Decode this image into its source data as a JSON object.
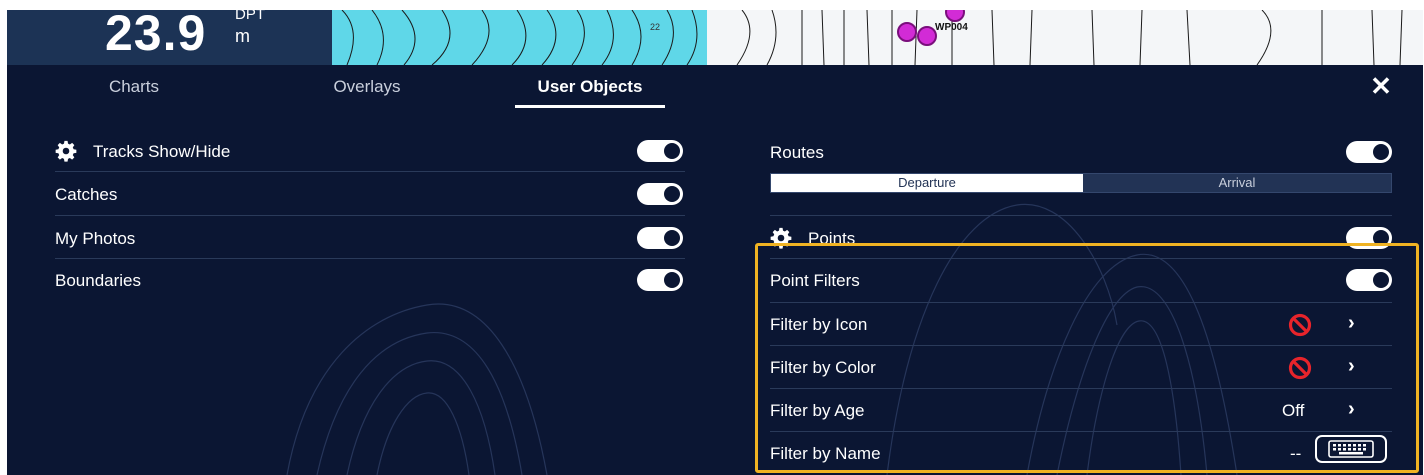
{
  "depth": {
    "value": "23.9",
    "label": "DPT",
    "unit": "m"
  },
  "chart": {
    "sounding": "22",
    "waypoint_label": "WP004"
  },
  "tabs": [
    {
      "label": "Charts",
      "active": false
    },
    {
      "label": "Overlays",
      "active": false
    },
    {
      "label": "User Objects",
      "active": true
    }
  ],
  "close_label": "✕",
  "left_settings": [
    {
      "label": "Tracks Show/Hide",
      "has_gear": true,
      "toggle": "on"
    },
    {
      "label": "Catches",
      "has_gear": false,
      "toggle": "on"
    },
    {
      "label": "My Photos",
      "has_gear": false,
      "toggle": "on"
    },
    {
      "label": "Boundaries",
      "has_gear": false,
      "toggle": "on"
    }
  ],
  "routes": {
    "label": "Routes",
    "toggle": "on",
    "segments": [
      "Departure",
      "Arrival"
    ],
    "selected": "Departure"
  },
  "points": {
    "label": "Points",
    "toggle": "on"
  },
  "point_filters": {
    "label": "Point Filters",
    "toggle": "on",
    "filters": [
      {
        "label": "Filter by Icon",
        "value_icon": "prohibited-icon",
        "chevron": "›"
      },
      {
        "label": "Filter by Color",
        "value_icon": "prohibited-icon",
        "chevron": "›"
      },
      {
        "label": "Filter by Age",
        "value": "Off",
        "chevron": "›"
      },
      {
        "label": "Filter by Name",
        "value": "--",
        "action_icon": "keyboard-icon"
      }
    ]
  },
  "colors": {
    "panel_bg": "#0b1633",
    "highlight": "#f0b323",
    "prohibited": "#e8242b",
    "waypoint": "#d22bd6",
    "shallow_water": "#5fd7e8"
  }
}
